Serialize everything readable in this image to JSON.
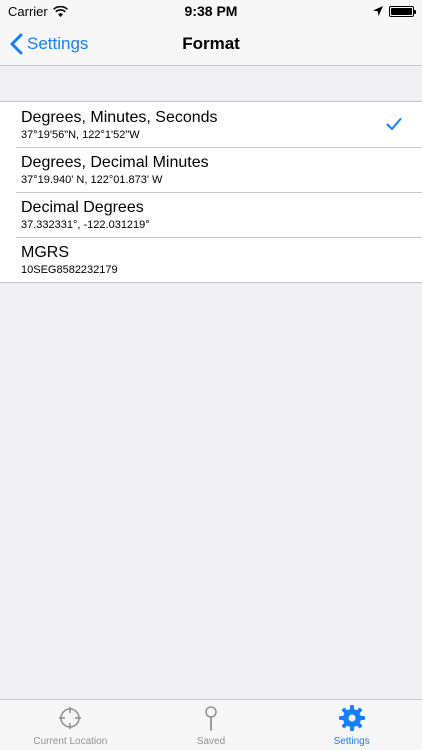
{
  "status_bar": {
    "carrier": "Carrier",
    "time": "9:38 PM"
  },
  "nav": {
    "back_label": "Settings",
    "title": "Format"
  },
  "formats": [
    {
      "title": "Degrees, Minutes, Seconds",
      "example": "37°19'56\"N, 122°1'52\"W",
      "selected": true
    },
    {
      "title": "Degrees, Decimal Minutes",
      "example": "37°19.940' N, 122°01.873' W",
      "selected": false
    },
    {
      "title": "Decimal Degrees",
      "example": "37.332331°, -122.031219°",
      "selected": false
    },
    {
      "title": "MGRS",
      "example": "10SEG8582232179",
      "selected": false
    }
  ],
  "tabs": [
    {
      "label": "Current Location",
      "icon": "crosshair-icon",
      "active": false
    },
    {
      "label": "Saved",
      "icon": "pin-icon",
      "active": false
    },
    {
      "label": "Settings",
      "icon": "gear-icon",
      "active": true
    }
  ],
  "colors": {
    "accent": "#157efb",
    "inactive": "#929292",
    "background": "#efeff4"
  }
}
